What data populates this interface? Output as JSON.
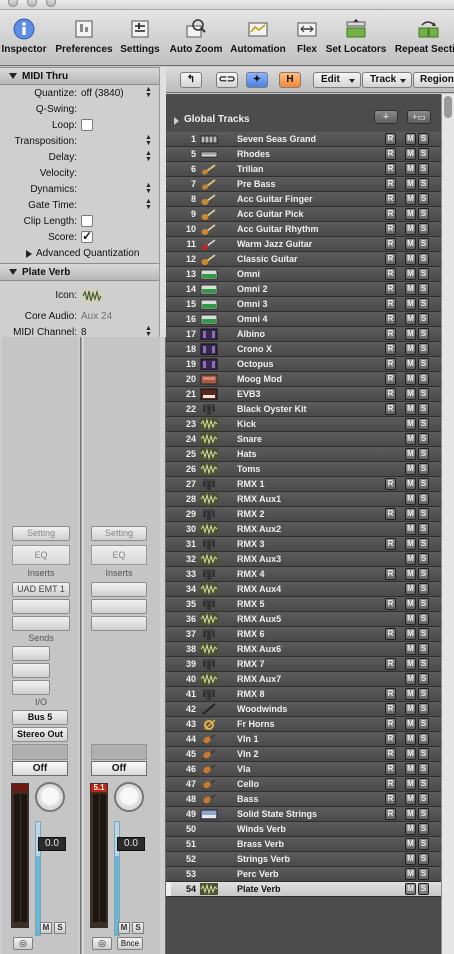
{
  "toolbar": {
    "items": [
      {
        "label": "Inspector",
        "icon": "info-icon"
      },
      {
        "label": "Preferences",
        "icon": "preferences-icon"
      },
      {
        "label": "Settings",
        "icon": "settings-icon"
      },
      {
        "label": "Auto Zoom",
        "icon": "auto-zoom-icon"
      },
      {
        "label": "Automation",
        "icon": "automation-icon"
      },
      {
        "label": "Flex",
        "icon": "flex-icon"
      },
      {
        "label": "Set Locators",
        "icon": "set-locators-icon"
      },
      {
        "label": "Repeat Sectio",
        "icon": "repeat-section-icon"
      }
    ]
  },
  "region": {
    "title": "MIDI Thru",
    "params": [
      {
        "label": "Quantize:",
        "value": "off (3840)"
      },
      {
        "label": "Q-Swing:",
        "value": ""
      },
      {
        "label": "Loop:",
        "value": ""
      },
      {
        "label": "Transposition:",
        "value": ""
      },
      {
        "label": "Delay:",
        "value": ""
      },
      {
        "label": "Velocity:",
        "value": ""
      },
      {
        "label": "Dynamics:",
        "value": ""
      },
      {
        "label": "Gate Time:",
        "value": ""
      },
      {
        "label": "Clip Length:",
        "value": ""
      },
      {
        "label": "Score:",
        "value": ""
      }
    ],
    "advanced": "Advanced Quantization"
  },
  "track": {
    "title": "Plate Verb",
    "icon_label": "Icon:",
    "core_audio_label": "Core Audio:",
    "core_audio_value": "Aux 24",
    "midi_channel_label": "MIDI Channel:",
    "midi_channel_value": "8"
  },
  "strip1": {
    "setting": "Setting",
    "eq": "EQ",
    "inserts": "Inserts",
    "insert1": "UAD EMT 1",
    "sends": "Sends",
    "io": "I/O",
    "input": "Bus 5",
    "output": "Stereo Out",
    "automation": "Off",
    "volume": "0.0",
    "mute": "M",
    "solo": "S",
    "link": "◎"
  },
  "strip2": {
    "setting": "Setting",
    "eq": "EQ",
    "inserts": "Inserts",
    "automation": "Off",
    "volume": "0.0",
    "peak": "5.1",
    "mute": "M",
    "solo": "S",
    "link": "◎",
    "bounce": "Bnce"
  },
  "arrange": {
    "edit": "Edit",
    "track": "Track",
    "region": "Region",
    "global_tracks": "Global Tracks",
    "add": "+",
    "add_folder": "+▭"
  },
  "colors": {
    "accent_blue": "#5c8ee6",
    "accent_orange": "#f39a3e",
    "meter_red": "#c42010",
    "fader_blue": "#69b6d7"
  },
  "tracks": [
    {
      "num": "1",
      "name": "Seven Seas Grand",
      "icon": "piano-icon",
      "r": true
    },
    {
      "num": "5",
      "name": "Rhodes",
      "icon": "keyboard-icon",
      "r": true
    },
    {
      "num": "6",
      "name": "Trilian",
      "icon": "bass-guitar-icon",
      "r": true
    },
    {
      "num": "7",
      "name": "Pre Bass",
      "icon": "bass-guitar-icon",
      "r": true
    },
    {
      "num": "8",
      "name": "Acc Guitar Finger",
      "icon": "guitar-icon",
      "r": true
    },
    {
      "num": "9",
      "name": "Acc Guitar Pick",
      "icon": "guitar-icon",
      "r": true
    },
    {
      "num": "10",
      "name": "Acc Guitar Rhythm",
      "icon": "guitar-icon",
      "r": true
    },
    {
      "num": "11",
      "name": "Warm Jazz Guitar",
      "icon": "electric-guitar-icon",
      "r": true
    },
    {
      "num": "12",
      "name": "Classic Guitar",
      "icon": "guitar-icon",
      "r": true
    },
    {
      "num": "13",
      "name": "Omni",
      "icon": "synth-icon",
      "r": true
    },
    {
      "num": "14",
      "name": "Omni 2",
      "icon": "synth-icon",
      "r": true
    },
    {
      "num": "15",
      "name": "Omni 3",
      "icon": "synth-icon",
      "r": true
    },
    {
      "num": "16",
      "name": "Omni 4",
      "icon": "synth-icon",
      "r": true
    },
    {
      "num": "17",
      "name": "Albino",
      "icon": "synth-module-icon",
      "r": true
    },
    {
      "num": "18",
      "name": "Crono X",
      "icon": "synth-module-icon",
      "r": true
    },
    {
      "num": "19",
      "name": "Octopus",
      "icon": "synth-module-icon",
      "r": true
    },
    {
      "num": "20",
      "name": "Moog Mod",
      "icon": "modular-synth-icon",
      "r": true
    },
    {
      "num": "21",
      "name": "EVB3",
      "icon": "organ-icon",
      "r": true
    },
    {
      "num": "22",
      "name": "Black Oyster Kit",
      "icon": "drum-kit-icon",
      "r": true
    },
    {
      "num": "23",
      "name": "Kick",
      "icon": "audio-waveform-icon",
      "r": false
    },
    {
      "num": "24",
      "name": "Snare",
      "icon": "audio-waveform-icon",
      "r": false
    },
    {
      "num": "25",
      "name": "Hats",
      "icon": "audio-waveform-icon",
      "r": false
    },
    {
      "num": "26",
      "name": "Toms",
      "icon": "audio-waveform-icon",
      "r": false
    },
    {
      "num": "27",
      "name": "RMX 1",
      "icon": "drum-kit-icon",
      "r": true
    },
    {
      "num": "28",
      "name": "RMX Aux1",
      "icon": "audio-waveform-icon",
      "r": false
    },
    {
      "num": "29",
      "name": "RMX 2",
      "icon": "drum-kit-icon",
      "r": true
    },
    {
      "num": "30",
      "name": "RMX Aux2",
      "icon": "audio-waveform-icon",
      "r": false
    },
    {
      "num": "31",
      "name": "RMX 3",
      "icon": "drum-kit-icon",
      "r": true
    },
    {
      "num": "32",
      "name": "RMX Aux3",
      "icon": "audio-waveform-icon",
      "r": false
    },
    {
      "num": "33",
      "name": "RMX 4",
      "icon": "drum-kit-icon",
      "r": true
    },
    {
      "num": "34",
      "name": "RMX Aux4",
      "icon": "audio-waveform-icon",
      "r": false
    },
    {
      "num": "35",
      "name": "RMX 5",
      "icon": "drum-kit-icon",
      "r": true
    },
    {
      "num": "36",
      "name": "RMX Aux5",
      "icon": "audio-waveform-icon",
      "r": false
    },
    {
      "num": "37",
      "name": "RMX 6",
      "icon": "drum-kit-icon",
      "r": true
    },
    {
      "num": "38",
      "name": "RMX Aux6",
      "icon": "audio-waveform-icon",
      "r": false
    },
    {
      "num": "39",
      "name": "RMX 7",
      "icon": "drum-kit-icon",
      "r": true
    },
    {
      "num": "40",
      "name": "RMX Aux7",
      "icon": "audio-waveform-icon",
      "r": false
    },
    {
      "num": "41",
      "name": "RMX 8",
      "icon": "drum-kit-icon",
      "r": true
    },
    {
      "num": "42",
      "name": "Woodwinds",
      "icon": "woodwind-icon",
      "r": true
    },
    {
      "num": "43",
      "name": "Fr Horns",
      "icon": "horn-icon",
      "r": true
    },
    {
      "num": "44",
      "name": "Vln 1",
      "icon": "violin-icon",
      "r": true
    },
    {
      "num": "45",
      "name": "Vln 2",
      "icon": "violin-icon",
      "r": true
    },
    {
      "num": "46",
      "name": "Vla",
      "icon": "violin-icon",
      "r": true
    },
    {
      "num": "47",
      "name": "Cello",
      "icon": "violin-icon",
      "r": true
    },
    {
      "num": "48",
      "name": "Bass",
      "icon": "violin-icon",
      "r": true
    },
    {
      "num": "49",
      "name": "Solid State Strings",
      "icon": "string-machine-icon",
      "r": true
    },
    {
      "num": "50",
      "name": "Winds Verb",
      "icon": "",
      "r": false
    },
    {
      "num": "51",
      "name": "Brass Verb",
      "icon": "",
      "r": false
    },
    {
      "num": "52",
      "name": "Strings Verb",
      "icon": "",
      "r": false
    },
    {
      "num": "53",
      "name": "Perc Verb",
      "icon": "",
      "r": false
    },
    {
      "num": "54",
      "name": "Plate Verb",
      "icon": "audio-waveform-icon",
      "r": false,
      "selected": true
    }
  ]
}
